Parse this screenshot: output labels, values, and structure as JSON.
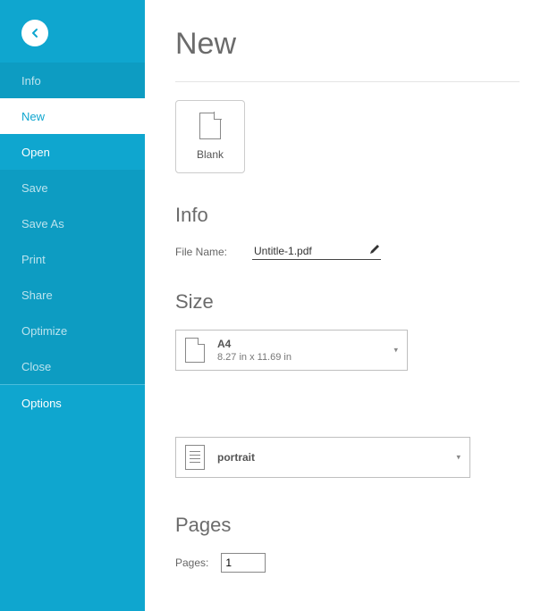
{
  "sidebar": {
    "items": [
      {
        "label": "Info",
        "state": "dim"
      },
      {
        "label": "New",
        "state": "active"
      },
      {
        "label": "Open",
        "state": "normal"
      },
      {
        "label": "Save",
        "state": "dim"
      },
      {
        "label": "Save As",
        "state": "dim"
      },
      {
        "label": "Print",
        "state": "dim"
      },
      {
        "label": "Share",
        "state": "dim"
      },
      {
        "label": "Optimize",
        "state": "dim"
      },
      {
        "label": "Close",
        "state": "dim"
      },
      {
        "label": "Options",
        "state": "normal"
      }
    ]
  },
  "page": {
    "title": "New",
    "tile_label": "Blank",
    "info_heading": "Info",
    "file_name_label": "File Name:",
    "file_name_value": "Untitle-1.pdf",
    "size_heading": "Size",
    "size_option": {
      "title": "A4",
      "subtitle": "8.27 in x 11.69 in"
    },
    "orientation_option": {
      "title": "portrait"
    },
    "pages_heading": "Pages",
    "pages_label": "Pages:",
    "pages_value": "1"
  }
}
